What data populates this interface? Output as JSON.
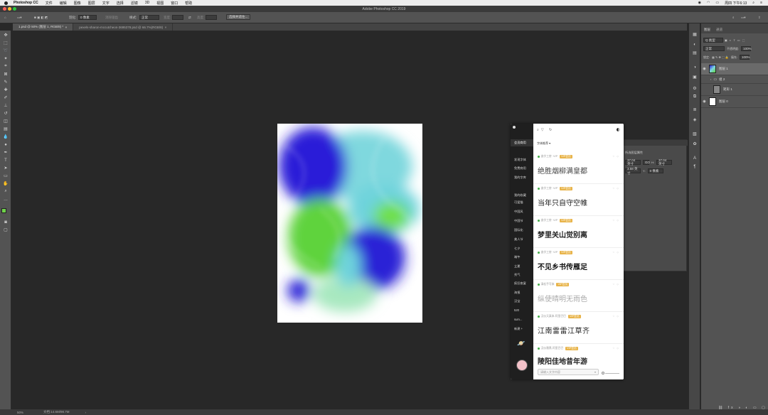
{
  "menubar": {
    "app": "Photoshop CC",
    "items": [
      "文件",
      "编辑",
      "图像",
      "图层",
      "文字",
      "选择",
      "滤镜",
      "3D",
      "视图",
      "窗口",
      "帮助"
    ],
    "clock": "周四 下午6:13"
  },
  "window": {
    "title": "Adobe Photoshop CC 2019"
  },
  "options": {
    "feather_label": "羽化:",
    "feather_value": "0 像素",
    "antialias_label": "消除锯齿",
    "style_label": "样式:",
    "style_value": "正常",
    "width_label": "宽度:",
    "height_label": "高度:",
    "select_mask_button": "选择并遮住..."
  },
  "tabs": [
    {
      "label": "1.psd @ 50% (图层 1, RGB/8) *",
      "active": true
    },
    {
      "label": "pexels-sharon-mccutcheon-3695378.psd @ 66.7%(RGB/8)",
      "active": false
    }
  ],
  "status": {
    "zoom": "50%",
    "doc": "文档:14.6M/98.7M"
  },
  "layers_panel": {
    "tabs": [
      "图层",
      "通道"
    ],
    "kind_label": "Q 类型",
    "blend_mode": "正常",
    "opacity_label": "不透明度:",
    "opacity_value": "100%",
    "lock_label": "锁定:",
    "fill_label": "填充:",
    "fill_value": "100%",
    "layers": [
      {
        "name": "图层 1",
        "selected": true,
        "visible": true
      },
      {
        "name": "组 2",
        "selected": false,
        "visible": false
      },
      {
        "name": "矩形 1",
        "selected": false,
        "visible": false
      },
      {
        "name": "图层 0",
        "selected": false,
        "visible": true
      }
    ]
  },
  "behind_panel": {
    "title": "所选图层属性",
    "w_label": "W:",
    "w_value": "37.04 英寸",
    "go_label": "GO",
    "h_label": "H:",
    "x_value": "3.58 英寸",
    "y_label": "Y:",
    "y_value": "0 像素"
  },
  "plugin": {
    "sidebar_top": "会员商用",
    "categories": [
      "发现字体",
      "免费商用",
      "我的字库",
      "我的收藏",
      "可爱猫",
      "中国风",
      "中国节",
      "国际化",
      "美人节",
      "七夕",
      "端午",
      "立夏",
      "秀气",
      "疯狂夜宴",
      "海报",
      "汉宝",
      "520",
      "sum...",
      "新建 +"
    ],
    "filter_label": "字体推荐",
    "fonts": [
      {
        "meta": "造字工房 ·VIP",
        "tag": "VIP会员",
        "sample": "绝胜烟柳满皇都",
        "weight": "300"
      },
      {
        "meta": "造字工房 ·VIP",
        "tag": "VIP会员",
        "sample": "当年只自守空帷",
        "weight": "400"
      },
      {
        "meta": "造字工房 ·VIP",
        "tag": "VIP会员",
        "sample": "梦里关山觉别离",
        "weight": "700"
      },
      {
        "meta": "造字工房 ·VIP",
        "tag": "VIP会员",
        "sample": "不见乡书传雁足",
        "weight": "700"
      },
      {
        "meta": "清松手写体",
        "tag": "VIP会员",
        "sample": "纵使晴明无雨色",
        "weight": "200"
      },
      {
        "meta": "汉仪天真体-阿里巴巴",
        "tag": "VIP会员",
        "sample": "江南雷雷江草齐",
        "weight": "400"
      },
      {
        "meta": "汉仪雅黑-阿里巴巴",
        "tag": "VIP会员",
        "sample": "陵阳佳地昔年游",
        "weight": "700"
      }
    ],
    "search_placeholder": "请输入文字内容"
  },
  "colors": {
    "fg": "#6fd24a",
    "bg": "#ffffff",
    "vip": "#e8b44a"
  }
}
